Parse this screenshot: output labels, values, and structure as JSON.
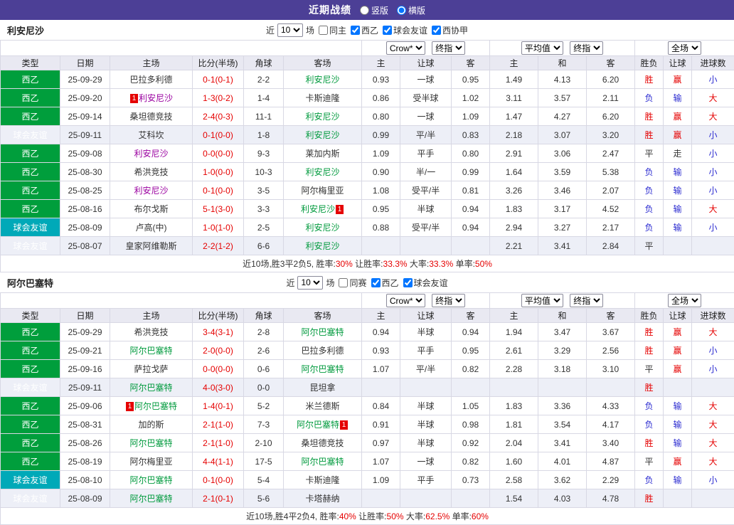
{
  "palette": {
    "topbar_bg": "#4c3f96",
    "league_green": "#009e3c",
    "league_teal": "#00a9b8",
    "red": "#e50000",
    "blue": "#2a2ad0",
    "green": "#009a3d",
    "purple": "#9a00a0",
    "black": "#333333"
  },
  "topbar": {
    "title": "近期战绩",
    "options": [
      {
        "label": "竖版",
        "selected": false
      },
      {
        "label": "横版",
        "selected": true
      }
    ]
  },
  "controls": {
    "odds_source": "Crow*",
    "final_odds": "终指",
    "average": "平均值",
    "full_match": "全场"
  },
  "columns": [
    "类型",
    "日期",
    "主场",
    "比分(半场)",
    "角球",
    "客场",
    "主",
    "让球",
    "客",
    "主",
    "和",
    "客",
    "胜负",
    "让球",
    "进球数"
  ],
  "sections": [
    {
      "team": "利安尼沙",
      "filter": {
        "prefix": "近",
        "count": "10",
        "suffix": "场",
        "checkboxes": [
          {
            "label": "同主",
            "checked": false
          },
          {
            "label": "西乙",
            "checked": true
          },
          {
            "label": "球会友谊",
            "checked": true
          },
          {
            "label": "西协甲",
            "checked": true
          }
        ]
      },
      "rows": [
        {
          "league": "西乙",
          "lg": "green",
          "date": "25-09-29",
          "home": {
            "n": "巴拉多利德",
            "c": "black"
          },
          "score": "0-1(0-1)",
          "corner": "2-2",
          "away": {
            "n": "利安尼沙",
            "c": "green"
          },
          "odds": [
            "0.93",
            "一球",
            "0.95"
          ],
          "avg": [
            "1.49",
            "4.13",
            "6.20"
          ],
          "res": {
            "t": "胜",
            "c": "red"
          },
          "cover": {
            "t": "赢",
            "c": "red"
          },
          "size": {
            "t": "小",
            "c": "blue"
          },
          "shade": false
        },
        {
          "league": "西乙",
          "lg": "green",
          "date": "25-09-20",
          "home": {
            "n": "利安尼沙",
            "c": "purple",
            "pre": "1"
          },
          "score": "1-3(0-2)",
          "corner": "1-4",
          "away": {
            "n": "卡斯迪隆",
            "c": "black"
          },
          "odds": [
            "0.86",
            "受半球",
            "1.02"
          ],
          "avg": [
            "3.11",
            "3.57",
            "2.11"
          ],
          "res": {
            "t": "负",
            "c": "blue"
          },
          "cover": {
            "t": "输",
            "c": "blue"
          },
          "size": {
            "t": "大",
            "c": "red"
          },
          "shade": false
        },
        {
          "league": "西乙",
          "lg": "green",
          "date": "25-09-14",
          "home": {
            "n": "桑坦德竞技",
            "c": "black"
          },
          "score": "2-4(0-3)",
          "corner": "11-1",
          "away": {
            "n": "利安尼沙",
            "c": "green"
          },
          "odds": [
            "0.80",
            "一球",
            "1.09"
          ],
          "avg": [
            "1.47",
            "4.27",
            "6.20"
          ],
          "res": {
            "t": "胜",
            "c": "red"
          },
          "cover": {
            "t": "赢",
            "c": "red"
          },
          "size": {
            "t": "大",
            "c": "red"
          },
          "shade": false
        },
        {
          "league": "球会友谊",
          "lg": "teal",
          "date": "25-09-11",
          "home": {
            "n": "艾科坎",
            "c": "black"
          },
          "score": "0-1(0-0)",
          "corner": "1-8",
          "away": {
            "n": "利安尼沙",
            "c": "green"
          },
          "odds": [
            "0.99",
            "平/半",
            "0.83"
          ],
          "avg": [
            "2.18",
            "3.07",
            "3.20"
          ],
          "res": {
            "t": "胜",
            "c": "red"
          },
          "cover": {
            "t": "赢",
            "c": "red"
          },
          "size": {
            "t": "小",
            "c": "blue"
          },
          "shade": true
        },
        {
          "league": "西乙",
          "lg": "green",
          "date": "25-09-08",
          "home": {
            "n": "利安尼沙",
            "c": "purple"
          },
          "score": "0-0(0-0)",
          "corner": "9-3",
          "away": {
            "n": "莱加内斯",
            "c": "black"
          },
          "odds": [
            "1.09",
            "平手",
            "0.80"
          ],
          "avg": [
            "2.91",
            "3.06",
            "2.47"
          ],
          "res": {
            "t": "平",
            "c": "black"
          },
          "cover": {
            "t": "走",
            "c": "black"
          },
          "size": {
            "t": "小",
            "c": "blue"
          },
          "shade": false
        },
        {
          "league": "西乙",
          "lg": "green",
          "date": "25-08-30",
          "home": {
            "n": "希洪竞技",
            "c": "black"
          },
          "score": "1-0(0-0)",
          "corner": "10-3",
          "away": {
            "n": "利安尼沙",
            "c": "green"
          },
          "odds": [
            "0.90",
            "半/一",
            "0.99"
          ],
          "avg": [
            "1.64",
            "3.59",
            "5.38"
          ],
          "res": {
            "t": "负",
            "c": "blue"
          },
          "cover": {
            "t": "输",
            "c": "blue"
          },
          "size": {
            "t": "小",
            "c": "blue"
          },
          "shade": false
        },
        {
          "league": "西乙",
          "lg": "green",
          "date": "25-08-25",
          "home": {
            "n": "利安尼沙",
            "c": "purple"
          },
          "score": "0-1(0-0)",
          "corner": "3-5",
          "away": {
            "n": "阿尔梅里亚",
            "c": "black"
          },
          "odds": [
            "1.08",
            "受平/半",
            "0.81"
          ],
          "avg": [
            "3.26",
            "3.46",
            "2.07"
          ],
          "res": {
            "t": "负",
            "c": "blue"
          },
          "cover": {
            "t": "输",
            "c": "blue"
          },
          "size": {
            "t": "小",
            "c": "blue"
          },
          "shade": false
        },
        {
          "league": "西乙",
          "lg": "green",
          "date": "25-08-16",
          "home": {
            "n": "布尔戈斯",
            "c": "black"
          },
          "score": "5-1(3-0)",
          "corner": "3-3",
          "away": {
            "n": "利安尼沙",
            "c": "green",
            "post": "1"
          },
          "odds": [
            "0.95",
            "半球",
            "0.94"
          ],
          "avg": [
            "1.83",
            "3.17",
            "4.52"
          ],
          "res": {
            "t": "负",
            "c": "blue"
          },
          "cover": {
            "t": "输",
            "c": "blue"
          },
          "size": {
            "t": "大",
            "c": "red"
          },
          "shade": false
        },
        {
          "league": "球会友谊",
          "lg": "teal",
          "date": "25-08-09",
          "home": {
            "n": "卢高(中)",
            "c": "black"
          },
          "score": "1-0(1-0)",
          "corner": "2-5",
          "away": {
            "n": "利安尼沙",
            "c": "green"
          },
          "odds": [
            "0.88",
            "受平/半",
            "0.94"
          ],
          "avg": [
            "2.94",
            "3.27",
            "2.17"
          ],
          "res": {
            "t": "负",
            "c": "blue"
          },
          "cover": {
            "t": "输",
            "c": "blue"
          },
          "size": {
            "t": "小",
            "c": "blue"
          },
          "shade": false
        },
        {
          "league": "球会友谊",
          "lg": "teal",
          "date": "25-08-07",
          "home": {
            "n": "皇家阿维勒斯",
            "c": "black"
          },
          "score": "2-2(1-2)",
          "corner": "6-6",
          "away": {
            "n": "利安尼沙",
            "c": "green"
          },
          "odds": [
            "",
            "",
            ""
          ],
          "avg": [
            "2.21",
            "3.41",
            "2.84"
          ],
          "res": {
            "t": "平",
            "c": "black"
          },
          "cover": {
            "t": "",
            "c": "black"
          },
          "size": {
            "t": "",
            "c": "black"
          },
          "shade": true
        }
      ],
      "summary": [
        {
          "t": "近10场,胜3平2负5, 胜率:",
          "red": false
        },
        {
          "t": "30%",
          "red": true
        },
        {
          "t": " 让胜率:",
          "red": false
        },
        {
          "t": "33.3%",
          "red": true
        },
        {
          "t": " 大率:",
          "red": false
        },
        {
          "t": "33.3%",
          "red": true
        },
        {
          "t": " 单率:",
          "red": false
        },
        {
          "t": "50%",
          "red": true
        }
      ]
    },
    {
      "team": "阿尔巴塞特",
      "filter": {
        "prefix": "近",
        "count": "10",
        "suffix": "场",
        "checkboxes": [
          {
            "label": "同赛",
            "checked": false
          },
          {
            "label": "西乙",
            "checked": true
          },
          {
            "label": "球会友谊",
            "checked": true
          }
        ]
      },
      "rows": [
        {
          "league": "西乙",
          "lg": "green",
          "date": "25-09-29",
          "home": {
            "n": "希洪竞技",
            "c": "black"
          },
          "score": "3-4(3-1)",
          "corner": "2-8",
          "away": {
            "n": "阿尔巴塞特",
            "c": "green"
          },
          "odds": [
            "0.94",
            "半球",
            "0.94"
          ],
          "avg": [
            "1.94",
            "3.47",
            "3.67"
          ],
          "res": {
            "t": "胜",
            "c": "red"
          },
          "cover": {
            "t": "赢",
            "c": "red"
          },
          "size": {
            "t": "大",
            "c": "red"
          },
          "shade": false
        },
        {
          "league": "西乙",
          "lg": "green",
          "date": "25-09-21",
          "home": {
            "n": "阿尔巴塞特",
            "c": "green"
          },
          "score": "2-0(0-0)",
          "corner": "2-6",
          "away": {
            "n": "巴拉多利德",
            "c": "black"
          },
          "odds": [
            "0.93",
            "平手",
            "0.95"
          ],
          "avg": [
            "2.61",
            "3.29",
            "2.56"
          ],
          "res": {
            "t": "胜",
            "c": "red"
          },
          "cover": {
            "t": "赢",
            "c": "red"
          },
          "size": {
            "t": "小",
            "c": "blue"
          },
          "shade": false
        },
        {
          "league": "西乙",
          "lg": "green",
          "date": "25-09-16",
          "home": {
            "n": "萨拉戈萨",
            "c": "black"
          },
          "score": "0-0(0-0)",
          "corner": "0-6",
          "away": {
            "n": "阿尔巴塞特",
            "c": "green"
          },
          "odds": [
            "1.07",
            "平/半",
            "0.82"
          ],
          "avg": [
            "2.28",
            "3.18",
            "3.10"
          ],
          "res": {
            "t": "平",
            "c": "black"
          },
          "cover": {
            "t": "赢",
            "c": "red"
          },
          "size": {
            "t": "小",
            "c": "blue"
          },
          "shade": false
        },
        {
          "league": "球会友谊",
          "lg": "teal",
          "date": "25-09-11",
          "home": {
            "n": "阿尔巴塞特",
            "c": "green"
          },
          "score": "4-0(3-0)",
          "corner": "0-0",
          "away": {
            "n": "昆坦拿",
            "c": "black"
          },
          "odds": [
            "",
            "",
            ""
          ],
          "avg": [
            "",
            "",
            ""
          ],
          "res": {
            "t": "胜",
            "c": "red"
          },
          "cover": {
            "t": "",
            "c": "black"
          },
          "size": {
            "t": "",
            "c": "black"
          },
          "shade": true
        },
        {
          "league": "西乙",
          "lg": "green",
          "date": "25-09-06",
          "home": {
            "n": "阿尔巴塞特",
            "c": "green",
            "pre": "1"
          },
          "score": "1-4(0-1)",
          "corner": "5-2",
          "away": {
            "n": "米兰德斯",
            "c": "black"
          },
          "odds": [
            "0.84",
            "半球",
            "1.05"
          ],
          "avg": [
            "1.83",
            "3.36",
            "4.33"
          ],
          "res": {
            "t": "负",
            "c": "blue"
          },
          "cover": {
            "t": "输",
            "c": "blue"
          },
          "size": {
            "t": "大",
            "c": "red"
          },
          "shade": false
        },
        {
          "league": "西乙",
          "lg": "green",
          "date": "25-08-31",
          "home": {
            "n": "加的斯",
            "c": "black"
          },
          "score": "2-1(1-0)",
          "corner": "7-3",
          "away": {
            "n": "阿尔巴塞特",
            "c": "green",
            "post": "1"
          },
          "odds": [
            "0.91",
            "半球",
            "0.98"
          ],
          "avg": [
            "1.81",
            "3.54",
            "4.17"
          ],
          "res": {
            "t": "负",
            "c": "blue"
          },
          "cover": {
            "t": "输",
            "c": "blue"
          },
          "size": {
            "t": "大",
            "c": "red"
          },
          "shade": false
        },
        {
          "league": "西乙",
          "lg": "green",
          "date": "25-08-26",
          "home": {
            "n": "阿尔巴塞特",
            "c": "green"
          },
          "score": "2-1(1-0)",
          "corner": "2-10",
          "away": {
            "n": "桑坦德竞技",
            "c": "black"
          },
          "odds": [
            "0.97",
            "半球",
            "0.92"
          ],
          "avg": [
            "2.04",
            "3.41",
            "3.40"
          ],
          "res": {
            "t": "胜",
            "c": "red"
          },
          "cover": {
            "t": "输",
            "c": "blue"
          },
          "size": {
            "t": "大",
            "c": "red"
          },
          "shade": false
        },
        {
          "league": "西乙",
          "lg": "green",
          "date": "25-08-19",
          "home": {
            "n": "阿尔梅里亚",
            "c": "black"
          },
          "score": "4-4(1-1)",
          "corner": "17-5",
          "away": {
            "n": "阿尔巴塞特",
            "c": "green"
          },
          "odds": [
            "1.07",
            "一球",
            "0.82"
          ],
          "avg": [
            "1.60",
            "4.01",
            "4.87"
          ],
          "res": {
            "t": "平",
            "c": "black"
          },
          "cover": {
            "t": "赢",
            "c": "red"
          },
          "size": {
            "t": "大",
            "c": "red"
          },
          "shade": false
        },
        {
          "league": "球会友谊",
          "lg": "teal",
          "date": "25-08-10",
          "home": {
            "n": "阿尔巴塞特",
            "c": "green"
          },
          "score": "0-1(0-0)",
          "corner": "5-4",
          "away": {
            "n": "卡斯迪隆",
            "c": "black"
          },
          "odds": [
            "1.09",
            "平手",
            "0.73"
          ],
          "avg": [
            "2.58",
            "3.62",
            "2.29"
          ],
          "res": {
            "t": "负",
            "c": "blue"
          },
          "cover": {
            "t": "输",
            "c": "blue"
          },
          "size": {
            "t": "小",
            "c": "blue"
          },
          "shade": false
        },
        {
          "league": "球会友谊",
          "lg": "teal",
          "date": "25-08-09",
          "home": {
            "n": "阿尔巴塞特",
            "c": "green"
          },
          "score": "2-1(0-1)",
          "corner": "5-6",
          "away": {
            "n": "卡塔赫纳",
            "c": "black"
          },
          "odds": [
            "",
            "",
            ""
          ],
          "avg": [
            "1.54",
            "4.03",
            "4.78"
          ],
          "res": {
            "t": "胜",
            "c": "red"
          },
          "cover": {
            "t": "",
            "c": "black"
          },
          "size": {
            "t": "",
            "c": "black"
          },
          "shade": true
        }
      ],
      "summary": [
        {
          "t": "近10场,胜4平2负4, 胜率:",
          "red": false
        },
        {
          "t": "40%",
          "red": true
        },
        {
          "t": " 让胜率:",
          "red": false
        },
        {
          "t": "50%",
          "red": true
        },
        {
          "t": " 大率:",
          "red": false
        },
        {
          "t": "62.5%",
          "red": true
        },
        {
          "t": " 单率:",
          "red": false
        },
        {
          "t": "60%",
          "red": true
        }
      ]
    }
  ]
}
